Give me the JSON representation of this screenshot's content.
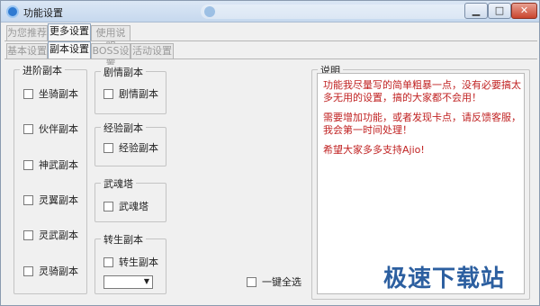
{
  "window": {
    "title": "功能设置"
  },
  "top_tabs": [
    "为您推荐",
    "更多设置",
    "使用说明"
  ],
  "sub_tabs": [
    "基本设置",
    "副本设置",
    "BOSS设置",
    "活动设置"
  ],
  "advanced": {
    "title": "进阶副本",
    "items": [
      "坐骑副本",
      "伙伴副本",
      "神武副本",
      "灵翼副本",
      "灵武副本",
      "灵骑副本"
    ]
  },
  "plot": {
    "title": "剧情副本",
    "item": "剧情副本"
  },
  "exp": {
    "title": "经验副本",
    "item": "经验副本"
  },
  "tower": {
    "title": "武魂塔",
    "item": "武魂塔"
  },
  "rebirth": {
    "title": "转生副本",
    "item": "转生副本",
    "select_value": ""
  },
  "select_all": {
    "label": "一键全选"
  },
  "notes": {
    "title": "说明",
    "lines": [
      "功能我尽量写的简单粗暴一点，没有必要搞太多无用的设置，搞的大家都不会用！",
      "需要增加功能，或者发现卡点，请反馈客服，我会第一时间处理！",
      "希望大家多多支持Ajio!"
    ],
    "color": "#c02222"
  },
  "watermark": "极速下载站"
}
